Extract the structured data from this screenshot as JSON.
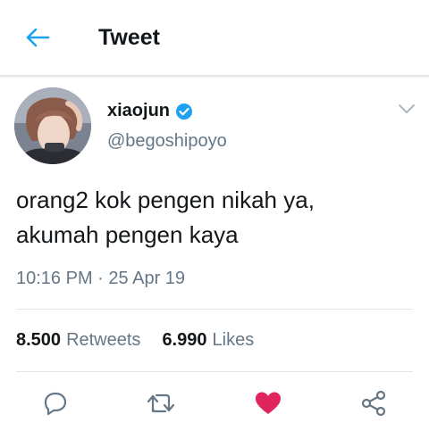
{
  "header": {
    "title": "Tweet",
    "back_icon": "arrow-left-icon"
  },
  "colors": {
    "accent": "#1da1f2",
    "like": "#e0245e",
    "text": "#14171a",
    "muted": "#657786"
  },
  "tweet": {
    "author": {
      "name": "xiaojun",
      "handle": "@begoshipoyo",
      "verified": true
    },
    "text_lines": [
      "orang2 kok pengen nikah ya,",
      "akumah pengen kaya"
    ],
    "time": "10:16 PM",
    "separator": "·",
    "date": "25 Apr 19",
    "retweets": {
      "count": "8.500",
      "label": "Retweets"
    },
    "likes": {
      "count": "6.990",
      "label": "Likes"
    },
    "liked": true
  },
  "actions": [
    "reply-icon",
    "retweet-icon",
    "heart-icon",
    "share-icon"
  ]
}
